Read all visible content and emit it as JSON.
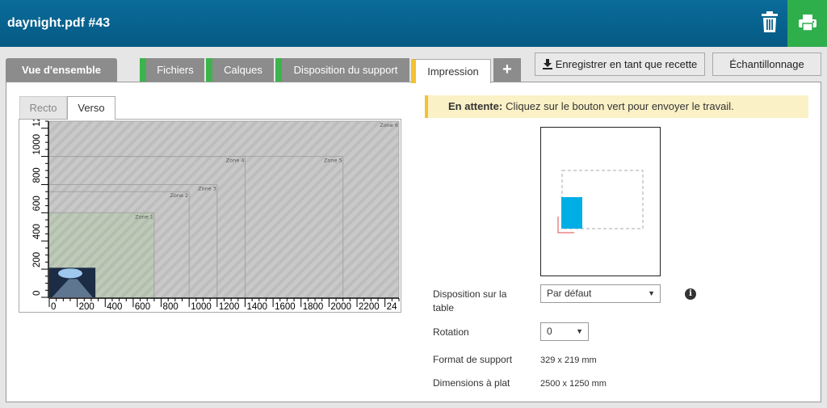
{
  "window": {
    "title": "daynight.pdf #43"
  },
  "header": {
    "trash_icon": "trash-icon",
    "print_icon": "printer-icon",
    "print_color": "#2fae4c"
  },
  "tabs": [
    {
      "label": "Vue d'ensemble"
    },
    {
      "label": "Fichiers"
    },
    {
      "label": "Calques"
    },
    {
      "label": "Disposition du support"
    },
    {
      "label": "Impression"
    },
    {
      "label": "+"
    }
  ],
  "toolbar": {
    "save_recipe": "Enregistrer en tant que recette",
    "sampling": "Échantillonnage"
  },
  "side_tabs": {
    "recto": "Recto",
    "verso": "Verso"
  },
  "chart_data": {
    "type": "table-layout",
    "x_ticks": [
      "0",
      "200",
      "400",
      "600",
      "800",
      "1000",
      "1200",
      "1400",
      "1600",
      "1800",
      "2000",
      "2200",
      "24"
    ],
    "y_ticks": [
      "0",
      "200",
      "400",
      "600",
      "800",
      "1000",
      "1200"
    ],
    "zones": [
      {
        "label": "Zone 1",
        "x": 750,
        "y": 600
      },
      {
        "label": "Zone 2",
        "x": 1000,
        "y": 750
      },
      {
        "label": "Zone 3",
        "x": 1200,
        "y": 800
      },
      {
        "label": "Zone 4",
        "x": 1400,
        "y": 1000
      },
      {
        "label": "Zone 5",
        "x": 2100,
        "y": 1000
      },
      {
        "label": "Zone 6",
        "x": 2500,
        "y": 1250
      }
    ],
    "xlim": [
      0,
      2500
    ],
    "ylim": [
      0,
      1250
    ]
  },
  "status": {
    "label": "En attente:",
    "message": "Cliquez sur le bouton vert pour envoyer le travail."
  },
  "form": {
    "table_layout_label": "Disposition sur la table",
    "table_layout_value": "Par défaut",
    "rotation_label": "Rotation",
    "rotation_value": "0",
    "media_format_label": "Format de support",
    "media_format_value": "329 x 219 mm",
    "flat_dimensions_label": "Dimensions à plat",
    "flat_dimensions_value": "2500 x 1250 mm"
  }
}
